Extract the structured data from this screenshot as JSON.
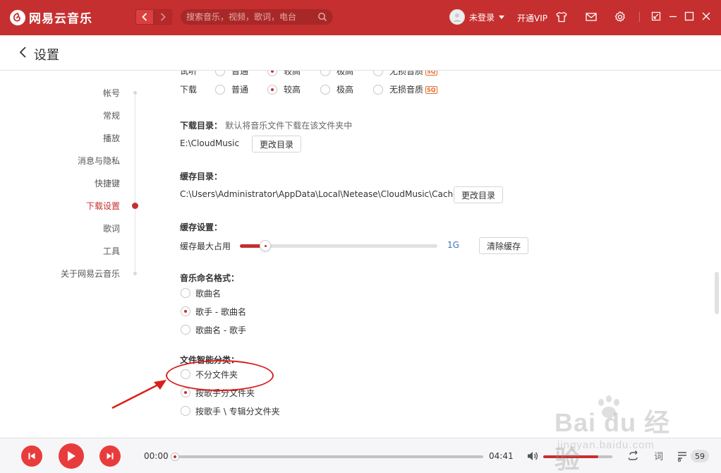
{
  "app": {
    "name": "网易云音乐",
    "brand_color": "#c62f2f"
  },
  "titlebar": {
    "search_placeholder": "搜索音乐，视频，歌词，电台",
    "user_name": "未登录",
    "vip_label": "开通VIP",
    "icons": [
      "skin-icon",
      "mail-icon",
      "gear-icon",
      "mini-mode-icon",
      "minimize-icon",
      "maximize-icon",
      "close-icon"
    ]
  },
  "header": {
    "title": "设置"
  },
  "sidebar": {
    "items": [
      {
        "label": "帐号",
        "active": false
      },
      {
        "label": "常规",
        "active": false
      },
      {
        "label": "播放",
        "active": false
      },
      {
        "label": "消息与隐私",
        "active": false
      },
      {
        "label": "快捷键",
        "active": false
      },
      {
        "label": "下载设置",
        "active": true
      },
      {
        "label": "歌词",
        "active": false
      },
      {
        "label": "工具",
        "active": false
      },
      {
        "label": "关于网易云音乐",
        "active": false
      }
    ]
  },
  "quality": {
    "rows": [
      {
        "label": "试听",
        "options": [
          "普通",
          "较高",
          "极高",
          "无损音质"
        ],
        "selected": 1
      },
      {
        "label": "下载",
        "options": [
          "普通",
          "较高",
          "极高",
          "无损音质"
        ],
        "selected": 1
      }
    ],
    "sq_badge": "SQ"
  },
  "download_dir": {
    "title": "下载目录：",
    "hint": "默认将音乐文件下载在该文件夹中",
    "path": "E:\\CloudMusic",
    "button": "更改目录"
  },
  "cache_dir": {
    "title": "缓存目录：",
    "path": "C:\\Users\\Administrator\\AppData\\Local\\Netease\\CloudMusic\\Cache",
    "button": "更改目录"
  },
  "cache_settings": {
    "title": "缓存设置：",
    "label": "缓存最大占用",
    "value": "1G",
    "slider_fraction": 0.08,
    "button": "清除缓存"
  },
  "naming": {
    "title": "音乐命名格式：",
    "options": [
      "歌曲名",
      "歌手 - 歌曲名",
      "歌曲名 - 歌手"
    ],
    "selected": 1
  },
  "smart_folder": {
    "title": "文件智能分类：",
    "options": [
      "不分文件夹",
      "按歌手分文件夹",
      "按歌手 \\ 专辑分文件夹"
    ],
    "selected": 1
  },
  "player": {
    "current_time": "00:00",
    "total_time": "04:41",
    "progress_fraction": 0.0,
    "volume_fraction": 0.8,
    "lyric_label": "词",
    "playlist_count": "59"
  },
  "watermark": {
    "main": "Bai du 经验",
    "sub": "jingyan.baidu.com"
  }
}
